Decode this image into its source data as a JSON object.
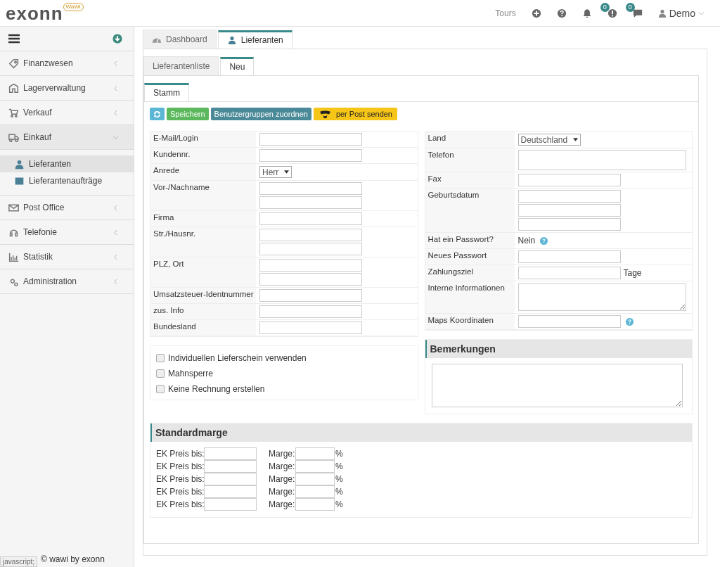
{
  "header": {
    "logo": "exonn",
    "logo_badge": "WaWi",
    "tours": "Tours",
    "alerts_badge": "0",
    "messages_badge": "0",
    "user": "Demo"
  },
  "sidebar": {
    "items": [
      {
        "label": "Finanzwesen",
        "expanded": false
      },
      {
        "label": "Lagerverwaltung",
        "expanded": false
      },
      {
        "label": "Verkauf",
        "expanded": false
      },
      {
        "label": "Einkauf",
        "expanded": true,
        "children": [
          {
            "label": "Lieferanten",
            "selected": true
          },
          {
            "label": "Lieferantenaufträge",
            "selected": false
          }
        ]
      },
      {
        "label": "Post Office",
        "expanded": false
      },
      {
        "label": "Telefonie",
        "expanded": false
      },
      {
        "label": "Statistik",
        "expanded": false
      },
      {
        "label": "Administration",
        "expanded": false
      }
    ],
    "footer": "© wawi by exonn"
  },
  "status_tooltip": "javascript;",
  "tabs": [
    {
      "label": "Dashboard",
      "selected": false
    },
    {
      "label": "Lieferanten",
      "selected": true
    }
  ],
  "subtabs": [
    {
      "label": "Lieferantenliste",
      "selected": false
    },
    {
      "label": "Neu",
      "selected": true
    }
  ],
  "form_tabs": [
    {
      "label": "Stamm",
      "selected": true
    }
  ],
  "toolbar": [
    {
      "kind": "refresh"
    },
    {
      "kind": "save",
      "label": "Speichern"
    },
    {
      "kind": "groups",
      "label": "Benutzergruppen zuordnen"
    },
    {
      "kind": "post",
      "label": "per Post senden"
    }
  ],
  "left_fields": [
    {
      "label": "E-Mail/Login",
      "kind": "input"
    },
    {
      "label": "Kundennr.",
      "kind": "input"
    },
    {
      "label": "Anrede",
      "kind": "select",
      "value": "Herr"
    },
    {
      "label": "Vor-/Nachname",
      "kind": "input2"
    },
    {
      "label": "Firma",
      "kind": "input"
    },
    {
      "label": "Str./Hausnr.",
      "kind": "input2"
    },
    {
      "label": "PLZ, Ort",
      "kind": "input2"
    },
    {
      "label": "Umsatzsteuer-Identnummer",
      "kind": "input"
    },
    {
      "label": "zus. Info",
      "kind": "input"
    },
    {
      "label": "Bundesland",
      "kind": "input"
    }
  ],
  "right_fields": [
    {
      "label": "Land",
      "kind": "select",
      "value": "Deutschland"
    },
    {
      "label": "Telefon",
      "kind": "tall"
    },
    {
      "label": "Fax",
      "kind": "input"
    },
    {
      "label": "Geburtsdatum",
      "kind": "input3"
    },
    {
      "label": "Hat ein Passwort?",
      "kind": "info",
      "value": "Nein",
      "help": true
    },
    {
      "label": "Neues Passwort",
      "kind": "input"
    },
    {
      "label": "Zahlungsziel",
      "kind": "input",
      "suffix": "Tage"
    },
    {
      "label": "Interne Informationen",
      "kind": "textarea"
    },
    {
      "label": "Maps Koordinaten",
      "kind": "input",
      "help": true
    }
  ],
  "checkboxes": [
    {
      "label": "Individuellen Lieferschein verwenden",
      "checked": false
    },
    {
      "label": "Mahnsperre",
      "checked": false
    },
    {
      "label": "Keine Rechnung erstellen",
      "checked": false
    }
  ],
  "remarks": {
    "title": "Bemerkungen"
  },
  "margins": {
    "title": "Standardmarge",
    "rows": [
      {
        "price_label": "EK Preis bis:",
        "margin_label": "Marge:",
        "unit": "%"
      },
      {
        "price_label": "EK Preis bis:",
        "margin_label": "Marge:",
        "unit": "%"
      },
      {
        "price_label": "EK Preis bis:",
        "margin_label": "Marge:",
        "unit": "%"
      },
      {
        "price_label": "EK Preis bis:",
        "margin_label": "Marge:",
        "unit": "%"
      },
      {
        "price_label": "EK Preis bis:",
        "margin_label": "Marge:",
        "unit": "%"
      }
    ]
  }
}
